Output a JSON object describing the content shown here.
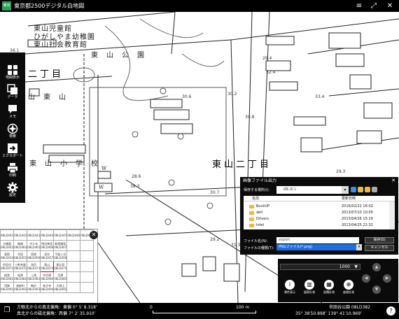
{
  "window": {
    "app_icon": "map-app-icon",
    "app_icon_text": "東京都",
    "title": "東京都2500デジタル白地図",
    "buttons": {
      "menu": "≡",
      "fullscreen": "⤢",
      "close": "✕"
    }
  },
  "map": {
    "labels": {
      "kindergarten_1": "東山児童館",
      "kindergarten_2": "ひがしやま幼稚園",
      "kindergarten_3": "東山社会教育館",
      "park": "東　山　公　園",
      "town_left": "二丁目",
      "town_left2": "山　東　山",
      "school": "東　山　小　学　校",
      "town": "東山二丁目",
      "w1": "W",
      "w2": "W"
    },
    "elevations": [
      "36.1",
      "29.4",
      "32.4",
      "30.8",
      "30.6",
      "30.2",
      "33.4",
      "29.3",
      "28.6",
      "38.3",
      "30.7",
      "29.2",
      "31.3"
    ]
  },
  "toolbar": {
    "items": [
      {
        "label": "地図表示",
        "icon": "grid-icon"
      },
      {
        "label": "データ",
        "icon": "layers-icon"
      },
      {
        "label": "メモ",
        "icon": "memo-icon"
      },
      {
        "label": "検索",
        "icon": "compass-icon"
      },
      {
        "label": "エクスポート",
        "icon": "export-icon"
      },
      {
        "label": "印刷",
        "icon": "print-icon"
      },
      {
        "label": "設定",
        "icon": "gear-icon"
      }
    ]
  },
  "mesh": {
    "rows": [
      [
        "08LD441",
        "08LD442",
        "08LD443",
        "08LD444",
        "08LD445",
        "08LD446",
        "08LD447"
      ],
      [
        "大橋東08LD463",
        "駒場08LD464",
        "代々木08LD465",
        "明治神宮08LD466",
        "新宿御苑08LD467",
        "",
        ""
      ],
      [
        "東宿08LD454",
        "代田08LD455",
        "西原08LD456",
        "初台08LD457",
        "千駄ヶ谷08LD458",
        "",
        ""
      ],
      [
        "世田谷08LD471",
        "三軒茶屋08LD472",
        "池尻08LD473",
        "東山08LD474",
        "恵比寿08LD475",
        "",
        ""
      ],
      [
        "経堂08LD481",
        "松原08LD482",
        "上馬08LD483",
        "中目黒08LD484",
        "目黒08LD485",
        "",
        ""
      ],
      [
        "用賀08LD491",
        "桜新町08LD492",
        "駒沢08LD493",
        "祐天寺08LD494",
        "大岡山08LD495",
        "",
        ""
      ]
    ],
    "close_label": "✕"
  },
  "dialog": {
    "title": "画像ファイル出力",
    "close": "✕",
    "location_label": "保存する場所(I):",
    "location_value": "OS (C:)",
    "columns": {
      "name": "名前",
      "date": "更新日時"
    },
    "files": [
      {
        "name": "BuckUP",
        "date": "2016/02/22 16:02"
      },
      {
        "name": "dell",
        "date": "2013/07/10 10:05"
      },
      {
        "name": "Drivers",
        "date": "2013/04/26 15:19"
      },
      {
        "name": "Intel",
        "date": "2013/04/25 22:32"
      }
    ],
    "filename_label": "ファイル名(N):",
    "filename_value": "export",
    "filetype_label": "ファイルの種類(T):",
    "filetype_value": "PNGファイル(*.png)",
    "save_button": "保存(S)",
    "cancel_button": "キャンセル"
  },
  "controls": {
    "scale_value": "1000",
    "scale_arrow": "▼",
    "buttons": [
      {
        "label": "属性表示",
        "icon": "info-icon",
        "glyph": "i"
      },
      {
        "label": "図郭計測",
        "icon": "frame-icon",
        "glyph": "▥"
      },
      {
        "label": "面積計測",
        "icon": "area-icon",
        "glyph": "▦"
      },
      {
        "label": "座標計測",
        "icon": "globe-icon",
        "glyph": "⊕"
      }
    ],
    "pan": {
      "up": "▲",
      "down": "▼",
      "left": "◀",
      "right": "▶"
    }
  },
  "status": {
    "north_line1": "方眼北からの真北偏角：東偏 0°  5′  8.318″",
    "north_line2": "真北からの磁北偏角：西偏 7°  2′  35.910″",
    "scale_zero": "0",
    "scale_label": "100 m",
    "place": "世田谷公園  08LD382",
    "coords": "35° 38′50.898″  139° 41′10.969″",
    "help": "?"
  },
  "colors": {
    "accent_blue": "#1e6fe0",
    "folder": "#e8b84a",
    "app_icon_green": "#2b9e5a"
  }
}
